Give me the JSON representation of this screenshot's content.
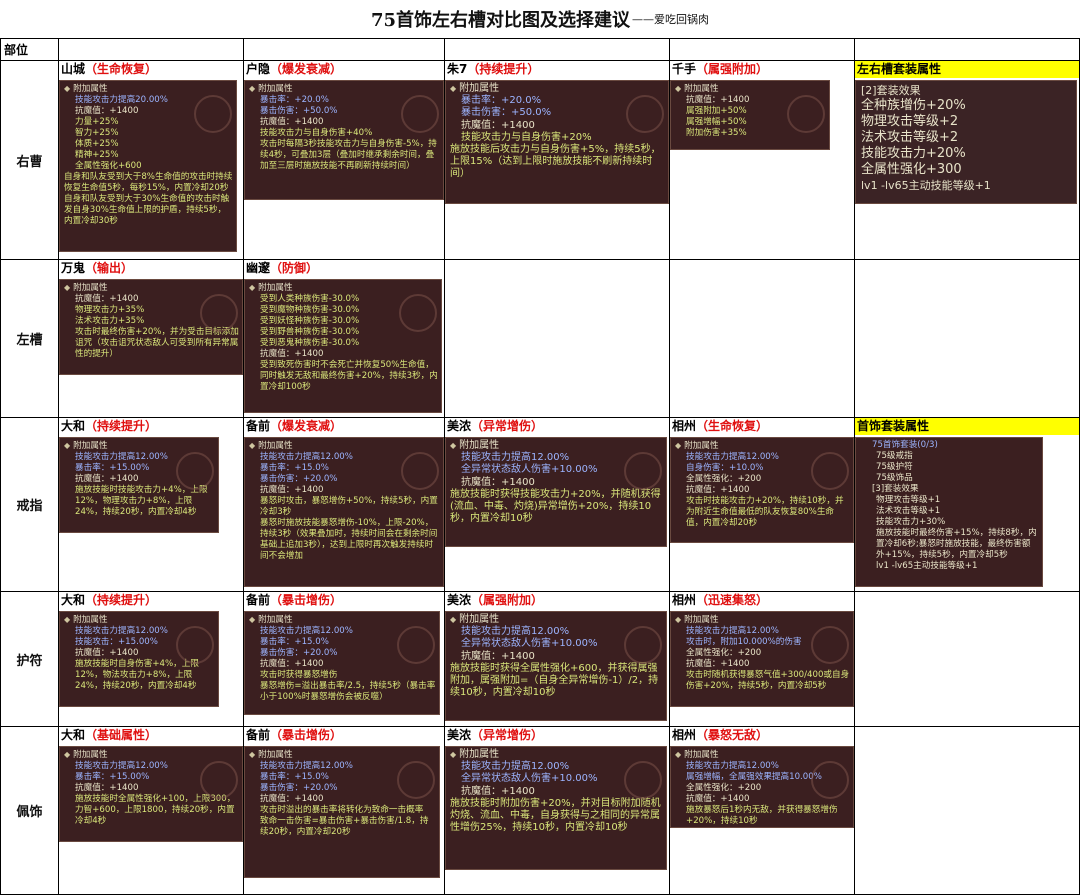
{
  "title": {
    "main": "75首饰左右槽对比图及选择建议",
    "suffix": "——爱吃回锅肉"
  },
  "header_label": "部位",
  "slots": {
    "right": "右曹",
    "left": "左槽",
    "ring": "戒指",
    "amulet": "护符",
    "pendant": "佩饰"
  },
  "card_header": "附加属性",
  "icons": {
    "diamond": "diamond-bullet-icon",
    "emblem": "item-emblem-icon"
  },
  "colors": {
    "attr_red": "#e01010",
    "highlight_yellow": "#ffff00",
    "card_bg": "#3b1f20",
    "blue_text": "#9cb4ff",
    "green_text": "#d9e67a"
  },
  "right": {
    "c1": {
      "name": "山城",
      "attr": "（生命恢复）",
      "lines": [
        {
          "t": "技能攻击力提高20.00%",
          "c": "blue"
        },
        {
          "t": "抗魔值：+1400",
          "c": "white"
        },
        {
          "t": "力量+25%",
          "c": "green"
        },
        {
          "t": "智力+25%",
          "c": "green"
        },
        {
          "t": "体质+25%",
          "c": "green"
        },
        {
          "t": "精神+25%",
          "c": "green"
        },
        {
          "t": "全属性强化+600",
          "c": "green"
        },
        {
          "t": "自身和队友受到大于8%生命值的攻击时持续恢复生命值5秒，每秒15%，内置冷却20秒",
          "c": "green",
          "n": true
        },
        {
          "t": "自身和队友受到大于30%生命值的攻击时触发自身30%生命值上限的护盾，持续5秒，内置冷却30秒",
          "c": "green",
          "n": true
        }
      ]
    },
    "c2": {
      "name": "户隐",
      "attr": "（爆发衰减）",
      "lines": [
        {
          "t": "暴击率：+20.0%",
          "c": "blue"
        },
        {
          "t": "暴击伤害：+50.0%",
          "c": "blue"
        },
        {
          "t": "抗魔值：+1400",
          "c": "white"
        },
        {
          "t": "技能攻击力与自身伤害+40%",
          "c": "green"
        },
        {
          "t": "攻击时每隔3秒技能攻击力与自身伤害-5%，持续4秒，可叠加3层（叠加时继承剩余时间，叠加至三层时施放技能不再刷新持续时间）",
          "c": "green"
        }
      ]
    },
    "c3": {
      "name": "朱7",
      "attr": "（持续提升）",
      "lines": [
        {
          "t": "暴击率：+20.0%",
          "c": "blue"
        },
        {
          "t": "暴击伤害：+50.0%",
          "c": "blue"
        },
        {
          "t": "抗魔值：+1400",
          "c": "white"
        },
        {
          "t": "技能攻击力与自身伤害+20%",
          "c": "green"
        },
        {
          "t": "施放技能后攻击力与自身伤害+5%，持续5秒，上限15%（达到上限时施放技能不刷新持续时间）",
          "c": "green",
          "n": true
        }
      ]
    },
    "c4": {
      "name": "千手",
      "attr": "（属强附加）",
      "lines": [
        {
          "t": "抗魔值：+1400",
          "c": "white"
        },
        {
          "t": "属强附加+50%",
          "c": "green"
        },
        {
          "t": "属强增幅+50%",
          "c": "green"
        },
        {
          "t": "附加伤害+35%",
          "c": "green"
        }
      ]
    },
    "c5": {
      "name": "左右槽套装属性",
      "lines": [
        "[2]套装效果",
        "全种族增伤+20%",
        "物理攻击等级+2",
        "法术攻击等级+2",
        "技能攻击力+20%",
        "全属性强化+300",
        "lv1 -lv65主动技能等级+1"
      ]
    }
  },
  "left": {
    "c1": {
      "name": "万鬼",
      "attr": "（输出）",
      "lines": [
        {
          "t": "抗魔值：+1400",
          "c": "white"
        },
        {
          "t": "物理攻击力+35%",
          "c": "green"
        },
        {
          "t": "法术攻击力+35%",
          "c": "green"
        },
        {
          "t": "攻击时最终伤害+20%，并为受击目标添加诅咒（攻击诅咒状态敌人可受到所有异常属性的提升）",
          "c": "green"
        }
      ]
    },
    "c2": {
      "name": "幽邃",
      "attr": "（防御）",
      "lines": [
        {
          "t": "受到人类种族伤害-30.0%",
          "c": "green"
        },
        {
          "t": "受到魔物种族伤害-30.0%",
          "c": "green"
        },
        {
          "t": "受到妖怪种族伤害-30.0%",
          "c": "green"
        },
        {
          "t": "受到野兽种族伤害-30.0%",
          "c": "green"
        },
        {
          "t": "受到恶鬼种族伤害-30.0%",
          "c": "green"
        },
        {
          "t": "抗魔值：+1400",
          "c": "white"
        },
        {
          "t": "受到致死伤害时不会死亡并恢复50%生命值，同时触发无敌和最终伤害+20%，持续3秒，内置冷却100秒",
          "c": "green"
        }
      ]
    }
  },
  "ring": {
    "c1": {
      "name": "大和",
      "attr": "（持续提升）",
      "lines": [
        {
          "t": "技能攻击力提高12.00%",
          "c": "blue"
        },
        {
          "t": "暴击率：+15.00%",
          "c": "blue"
        },
        {
          "t": "抗魔值：+1400",
          "c": "white"
        },
        {
          "t": "施放技能时技能攻击力+4%，上限12%，物理攻击力+8%，上限24%，持续20秒，内置冷却4秒",
          "c": "green"
        }
      ]
    },
    "c2": {
      "name": "备前",
      "attr": "（爆发衰减）",
      "lines": [
        {
          "t": "技能攻击力提高12.00%",
          "c": "blue"
        },
        {
          "t": "暴击率：+15.0%",
          "c": "blue"
        },
        {
          "t": "暴击伤害：+20.0%",
          "c": "blue"
        },
        {
          "t": "抗魔值：+1400",
          "c": "white"
        },
        {
          "t": "暴怒时攻击，暴怒增伤+50%，持续5秒，内置冷却3秒",
          "c": "green"
        },
        {
          "t": "暴怒时施放技能暴怒增伤-10%，上限-20%，持续3秒（效果叠加时，持续时间会在剩余时间基础上追加3秒），达到上限时再次触发持续时间不会增加",
          "c": "green"
        }
      ]
    },
    "c3": {
      "name": "美浓",
      "attr": "（异常增伤）",
      "lines": [
        {
          "t": "技能攻击力提高12.00%",
          "c": "blue"
        },
        {
          "t": "全异常状态敌人伤害+10.00%",
          "c": "blue"
        },
        {
          "t": "抗魔值：+1400",
          "c": "white"
        },
        {
          "t": "施放技能时获得技能攻击力+20%，并随机获得(流血、中毒、灼烧)异常增伤+20%，持续10秒，内置冷却10秒",
          "c": "green",
          "n": true
        }
      ]
    },
    "c4": {
      "name": "相州",
      "attr": "（生命恢复）",
      "lines": [
        {
          "t": "技能攻击力提高12.00%",
          "c": "blue"
        },
        {
          "t": "自身伤害：+10.0%",
          "c": "blue"
        },
        {
          "t": "全属性强化：+200",
          "c": "white"
        },
        {
          "t": "抗魔值：+1400",
          "c": "white"
        },
        {
          "t": "攻击时技能攻击力+20%，持续10秒，并为附近生命值最低的队友恢复80%生命值，内置冷却20秒",
          "c": "green"
        }
      ]
    },
    "c5": {
      "name": "首饰套装属性",
      "lines": [
        {
          "t": "75首饰套装(0/3)",
          "c": "blue"
        },
        {
          "t": "75级戒指",
          "c": "white"
        },
        {
          "t": "75级护符",
          "c": "white"
        },
        {
          "t": "75级饰品",
          "c": "white"
        },
        {
          "t": "[3]套装效果",
          "c": "white"
        },
        {
          "t": "物理攻击等级+1",
          "c": "white"
        },
        {
          "t": "法术攻击等级+1",
          "c": "white"
        },
        {
          "t": "技能攻击力+30%",
          "c": "white"
        },
        {
          "t": "施放技能时最终伤害+15%，持续8秒，内置冷却6秒;暴怒时施放技能，最终伤害额外+15%，持续5秒，内置冷却5秒",
          "c": "white"
        },
        {
          "t": "lv1 -lv65主动技能等级+1",
          "c": "white"
        }
      ]
    }
  },
  "amulet": {
    "c1": {
      "name": "大和",
      "attr": "（持续提升）",
      "lines": [
        {
          "t": "技能攻击力提高12.00%",
          "c": "blue"
        },
        {
          "t": "技能攻击：+15.00%",
          "c": "blue"
        },
        {
          "t": "抗魔值：+1400",
          "c": "white"
        },
        {
          "t": "施放技能时自身伤害+4%，上限12%，物法攻击力+8%，上限24%，持续20秒，内置冷却4秒",
          "c": "green"
        }
      ]
    },
    "c2": {
      "name": "备前",
      "attr": "（暴击增伤）",
      "lines": [
        {
          "t": "技能攻击力提高12.00%",
          "c": "blue"
        },
        {
          "t": "暴击率：+15.0%",
          "c": "blue"
        },
        {
          "t": "暴击伤害：+20.0%",
          "c": "blue"
        },
        {
          "t": "抗魔值：+1400",
          "c": "white"
        },
        {
          "t": "攻击时获得暴怒增伤",
          "c": "green"
        },
        {
          "t": "暴怒增伤=溢出暴击率/2.5，持续5秒（暴击率小于100%时暴怒增伤会被反噬）",
          "c": "green"
        }
      ]
    },
    "c3": {
      "name": "美浓",
      "attr": "（属强附加）",
      "lines": [
        {
          "t": "技能攻击力提高12.00%",
          "c": "blue"
        },
        {
          "t": "全异常状态敌人伤害+10.00%",
          "c": "blue"
        },
        {
          "t": "抗魔值：+1400",
          "c": "white"
        },
        {
          "t": "施放技能时获得全属性强化+600，并获得属强附加，属强附加=（自身全异常增伤-1）/2，持续10秒，内置冷却10秒",
          "c": "green",
          "n": true
        }
      ]
    },
    "c4": {
      "name": "相州",
      "attr": "（迅速集怒）",
      "lines": [
        {
          "t": "技能攻击力提高12.00%",
          "c": "blue"
        },
        {
          "t": "攻击时，附加10.000%的伤害",
          "c": "blue"
        },
        {
          "t": "全属性强化：+200",
          "c": "white"
        },
        {
          "t": "抗魔值：+1400",
          "c": "white"
        },
        {
          "t": "攻击时随机获得暴怒气值+300/400或自身伤害+20%，持续5秒，内置冷却5秒",
          "c": "green"
        }
      ]
    }
  },
  "pendant": {
    "c1": {
      "name": "大和",
      "attr": "（基础属性）",
      "lines": [
        {
          "t": "技能攻击力提高12.00%",
          "c": "blue"
        },
        {
          "t": "暴击率：+15.00%",
          "c": "blue"
        },
        {
          "t": "抗魔值：+1400",
          "c": "white"
        },
        {
          "t": "施放技能时全属性强化+100，上限300，力智+600，上限1800，持续20秒，内置冷却4秒",
          "c": "green"
        }
      ]
    },
    "c2": {
      "name": "备前",
      "attr": "（暴击增伤）",
      "lines": [
        {
          "t": "技能攻击力提高12.00%",
          "c": "blue"
        },
        {
          "t": "暴击率：+15.0%",
          "c": "blue"
        },
        {
          "t": "暴击伤害：+20.0%",
          "c": "blue"
        },
        {
          "t": "抗魔值：+1400",
          "c": "white"
        },
        {
          "t": "攻击时溢出的暴击率将转化为致命一击概率",
          "c": "green"
        },
        {
          "t": "致命一击伤害=暴击伤害+暴击伤害/1.8，持续20秒，内置冷却20秒",
          "c": "green"
        }
      ]
    },
    "c3": {
      "name": "美浓",
      "attr": "（异常增伤）",
      "lines": [
        {
          "t": "技能攻击力提高12.00%",
          "c": "blue"
        },
        {
          "t": "全异常状态敌人伤害+10.00%",
          "c": "blue"
        },
        {
          "t": "抗魔值：+1400",
          "c": "white"
        },
        {
          "t": "施放技能时附加伤害+20%，并对目标附加随机灼烧、流血、中毒，自身获得与之相同的异常属性增伤25%，持续10秒，内置冷却10秒",
          "c": "green",
          "n": true
        }
      ]
    },
    "c4": {
      "name": "相州",
      "attr": "（暴怒无敌）",
      "lines": [
        {
          "t": "技能攻击力提高12.00%",
          "c": "blue"
        },
        {
          "t": "属强增幅，全属强效果提高10.00%",
          "c": "blue"
        },
        {
          "t": "全属性强化：+200",
          "c": "white"
        },
        {
          "t": "抗魔值：+1400",
          "c": "white"
        },
        {
          "t": "施放暴怒后1秒内无敌，并获得暴怒增伤+20%，持续10秒",
          "c": "green"
        }
      ]
    }
  }
}
